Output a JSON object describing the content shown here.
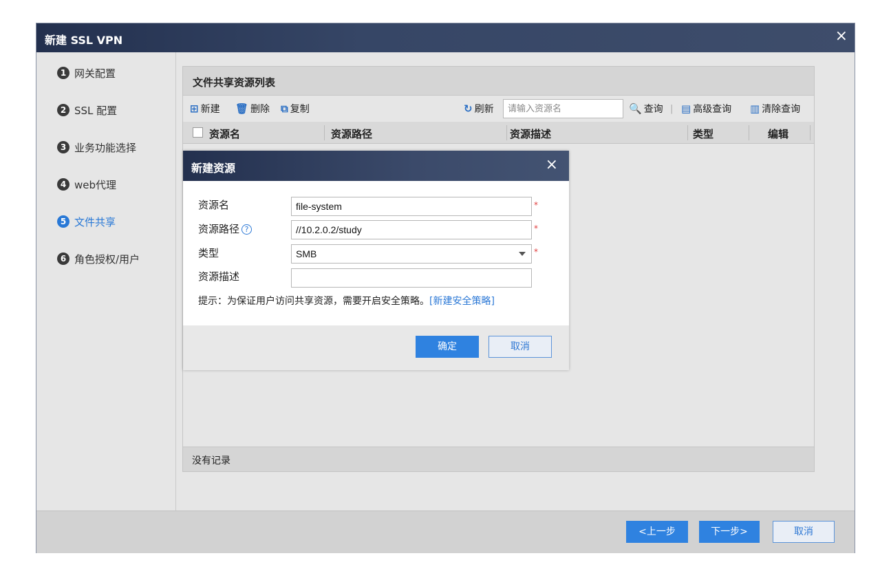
{
  "window": {
    "title": "新建 SSL VPN",
    "close_icon": "×"
  },
  "sidebar": {
    "steps": [
      {
        "num": "1",
        "label": "网关配置"
      },
      {
        "num": "2",
        "label": "SSL 配置"
      },
      {
        "num": "3",
        "label": "业务功能选择"
      },
      {
        "num": "4",
        "label": "web代理"
      },
      {
        "num": "5",
        "label": "文件共享"
      },
      {
        "num": "6",
        "label": "角色授权/用户"
      }
    ],
    "active_index": 4
  },
  "panel": {
    "title": "文件共享资源列表",
    "toolbar": {
      "new": "新建",
      "delete": "删除",
      "copy": "复制",
      "refresh": "刷新",
      "search_placeholder": "请输入资源名",
      "query": "查询",
      "advanced_query": "高级查询",
      "clear_query": "清除查询"
    },
    "columns": [
      "资源名",
      "资源路径",
      "资源描述",
      "类型",
      "编辑"
    ],
    "footer": "没有记录"
  },
  "modal": {
    "title": "新建资源",
    "close_icon": "×",
    "fields": {
      "name": {
        "label": "资源名",
        "value": "file-system"
      },
      "path": {
        "label": "资源路径",
        "value": "//10.2.0.2/study",
        "help": "?"
      },
      "type": {
        "label": "类型",
        "value": "SMB"
      },
      "desc": {
        "label": "资源描述",
        "value": ""
      }
    },
    "required_mark": "*",
    "hint_text": "提示：为保证用户访问共享资源，需要开启安全策略。",
    "hint_link": "[新建安全策略]",
    "confirm": "确定",
    "cancel": "取消"
  },
  "footer": {
    "prev": "<上一步",
    "next": "下一步>",
    "cancel": "取消"
  },
  "colors": {
    "accent": "#2f82e0",
    "title_bar": "#364666",
    "required": "#e04040"
  }
}
